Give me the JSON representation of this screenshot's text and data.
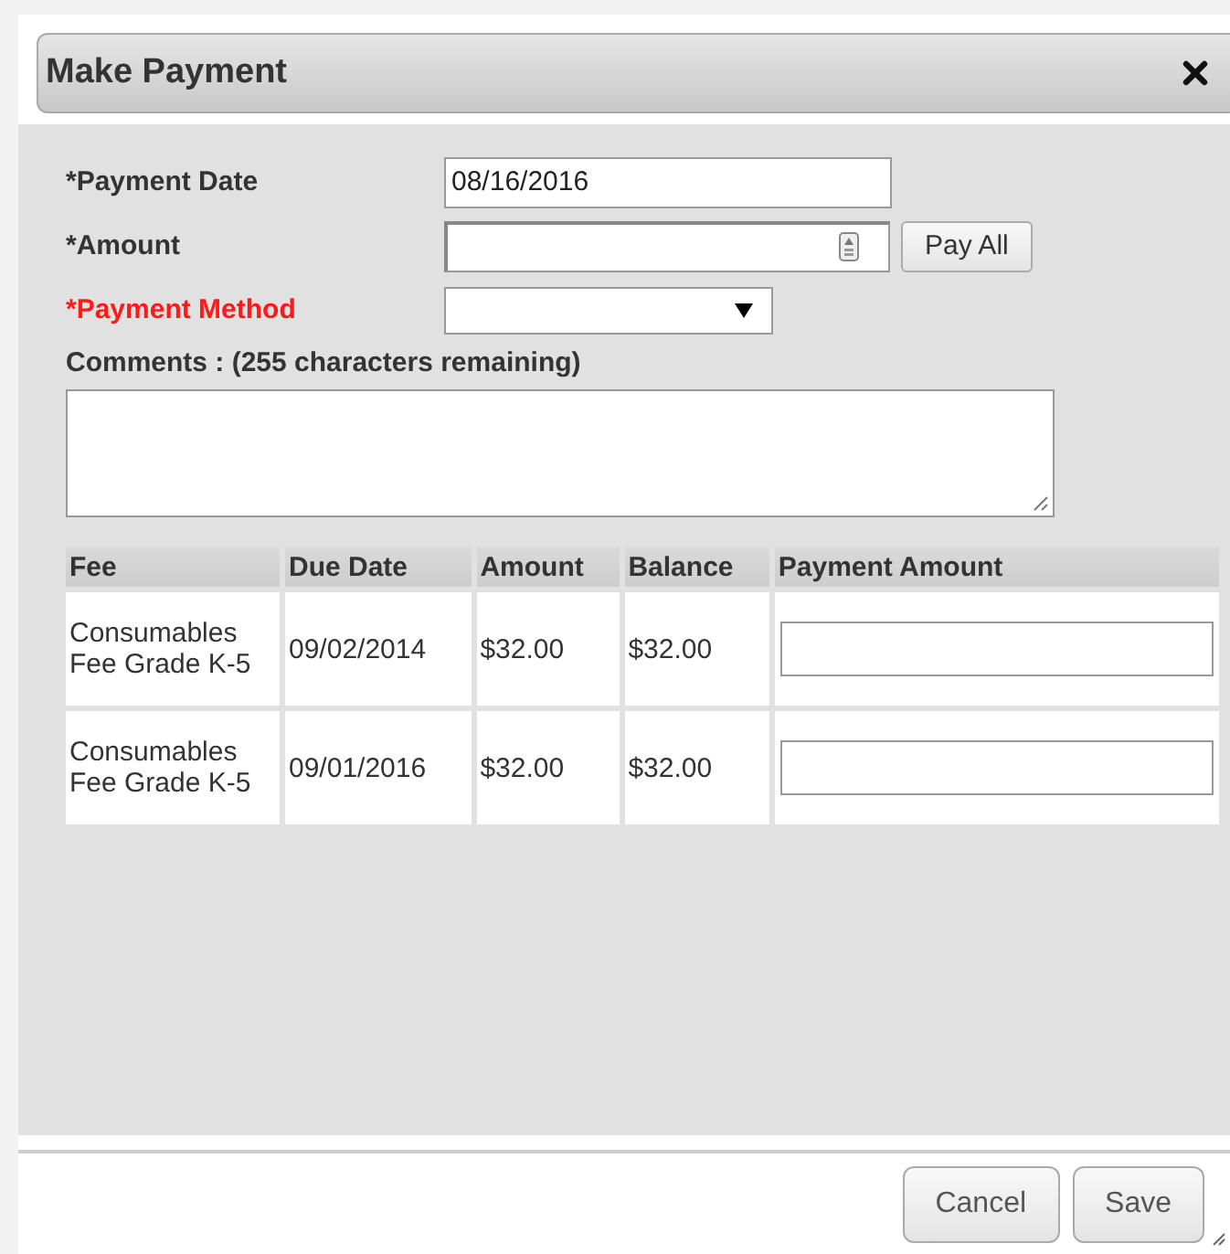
{
  "dialog": {
    "title": "Make Payment"
  },
  "form": {
    "payment_date": {
      "label": "*Payment Date",
      "value": "08/16/2016",
      "invalid": false
    },
    "amount": {
      "label": "*Amount",
      "invalid": false,
      "button": "Pay All"
    },
    "payment_method": {
      "label": "*Payment Method",
      "invalid": true
    },
    "comments": {
      "label": "Comments : (255 characters remaining)"
    }
  },
  "table": {
    "columns": [
      "Fee",
      "Due Date",
      "Amount",
      "Balance",
      "Payment Amount"
    ],
    "rows": [
      {
        "fee": "Consumables Fee Grade K-5",
        "due_date": "09/02/2014",
        "amount": "$32.00",
        "balance": "$32.00"
      },
      {
        "fee": "Consumables Fee Grade K-5",
        "due_date": "09/01/2016",
        "amount": "$32.00",
        "balance": "$32.00"
      }
    ]
  },
  "buttons": [
    "Cancel",
    "Save"
  ]
}
